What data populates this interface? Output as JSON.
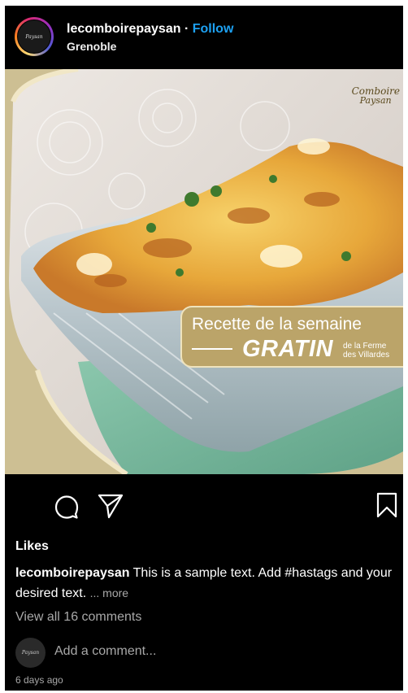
{
  "post": {
    "username": "lecomboirepaysan",
    "separator": "·",
    "follow_label": "Follow",
    "location": "Grenoble",
    "avatar_text": "Paysan",
    "image": {
      "brand_logo_line1": "Comboire",
      "brand_logo_line2": "Paysan",
      "badge_title": "Recette de la semaine",
      "badge_dish": "GRATIN",
      "badge_sub_line1": "de la Ferme",
      "badge_sub_line2": "des Villardes"
    },
    "likes_label": "Likes",
    "caption_text": " This is a sample text. Add #hastags and your desired text.",
    "more_label": "... more",
    "view_comments": "View all 16 comments",
    "add_comment_placeholder": "Add a comment...",
    "time_ago": "6 days ago"
  },
  "icons": {
    "comment": "comment-icon",
    "share": "share-icon",
    "save": "bookmark-icon"
  },
  "colors": {
    "background": "#000000",
    "follow": "#1da1f2",
    "muted_text": "#a8a8a8",
    "badge_gold": "#bba469"
  }
}
